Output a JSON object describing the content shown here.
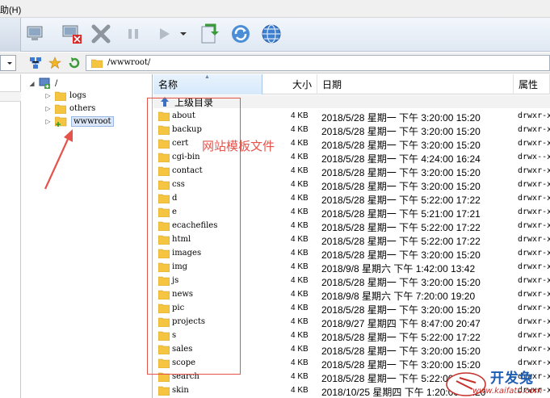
{
  "menubar": {
    "help_label": "助(H)"
  },
  "address": {
    "path": "/wwwroot/"
  },
  "tree": {
    "root": "/",
    "children": [
      {
        "label": "logs"
      },
      {
        "label": "others"
      },
      {
        "label": "wwwroot",
        "selected": true
      }
    ]
  },
  "list": {
    "columns": {
      "name": "名称",
      "size": "大小",
      "date": "日期",
      "attr": "属性"
    },
    "up_label": "上级目录",
    "rows": [
      {
        "name": "about",
        "size": "4 KB",
        "date": "2018/5/28 星期一 下午 3:20:00 15:20",
        "attr": "drwxr-x"
      },
      {
        "name": "backup",
        "size": "4 KB",
        "date": "2018/5/28 星期一 下午 3:20:00 15:20",
        "attr": "drwxr-x"
      },
      {
        "name": "cert",
        "size": "4 KB",
        "date": "2018/5/28 星期一 下午 3:20:00 15:20",
        "attr": "drwxr-x"
      },
      {
        "name": "cgi-bin",
        "size": "4 KB",
        "date": "2018/5/28 星期一 下午 4:24:00 16:24",
        "attr": "drwx--x"
      },
      {
        "name": "contact",
        "size": "4 KB",
        "date": "2018/5/28 星期一 下午 3:20:00 15:20",
        "attr": "drwxr-x"
      },
      {
        "name": "css",
        "size": "4 KB",
        "date": "2018/5/28 星期一 下午 3:20:00 15:20",
        "attr": "drwxr-x"
      },
      {
        "name": "d",
        "size": "4 KB",
        "date": "2018/5/28 星期一 下午 5:22:00 17:22",
        "attr": "drwxr-x"
      },
      {
        "name": "e",
        "size": "4 KB",
        "date": "2018/5/28 星期一 下午 5:21:00 17:21",
        "attr": "drwxr-x"
      },
      {
        "name": "ecachefiles",
        "size": "4 KB",
        "date": "2018/5/28 星期一 下午 5:22:00 17:22",
        "attr": "drwxr-x"
      },
      {
        "name": "html",
        "size": "4 KB",
        "date": "2018/5/28 星期一 下午 5:22:00 17:22",
        "attr": "drwxr-x"
      },
      {
        "name": "images",
        "size": "4 KB",
        "date": "2018/5/28 星期一 下午 3:20:00 15:20",
        "attr": "drwxr-x"
      },
      {
        "name": "img",
        "size": "4 KB",
        "date": "2018/9/8 星期六 下午 1:42:00 13:42",
        "attr": "drwxr-x"
      },
      {
        "name": "js",
        "size": "4 KB",
        "date": "2018/5/28 星期一 下午 3:20:00 15:20",
        "attr": "drwxr-x"
      },
      {
        "name": "news",
        "size": "4 KB",
        "date": "2018/9/8 星期六 下午 7:20:00 19:20",
        "attr": "drwxr-x"
      },
      {
        "name": "pic",
        "size": "4 KB",
        "date": "2018/5/28 星期一 下午 3:20:00 15:20",
        "attr": "drwxr-x"
      },
      {
        "name": "projects",
        "size": "4 KB",
        "date": "2018/9/27 星期四 下午 8:47:00 20:47",
        "attr": "drwxr-x"
      },
      {
        "name": "s",
        "size": "4 KB",
        "date": "2018/5/28 星期一 下午 5:22:00 17:22",
        "attr": "drwxr-x"
      },
      {
        "name": "sales",
        "size": "4 KB",
        "date": "2018/5/28 星期一 下午 3:20:00 15:20",
        "attr": "drwxr-x"
      },
      {
        "name": "scope",
        "size": "4 KB",
        "date": "2018/5/28 星期一 下午 3:20:00 15:20",
        "attr": "drwxr-x"
      },
      {
        "name": "search",
        "size": "4 KB",
        "date": "2018/5/28 星期一 下午 5:22:00 17:22",
        "attr": "drwxr-x"
      },
      {
        "name": "skin",
        "size": "4 KB",
        "date": "2018/10/25 星期四 下午 1:20:00 13:20",
        "attr": "drwxr-x"
      }
    ]
  },
  "annotation": {
    "text": "网站模板文件",
    "color": "#e5534b"
  },
  "watermark": {
    "main": "开发兔",
    "sub": "www.kaifatu.com"
  },
  "colors": {
    "folder": "#f5c542",
    "accent": "#1f5db0"
  }
}
